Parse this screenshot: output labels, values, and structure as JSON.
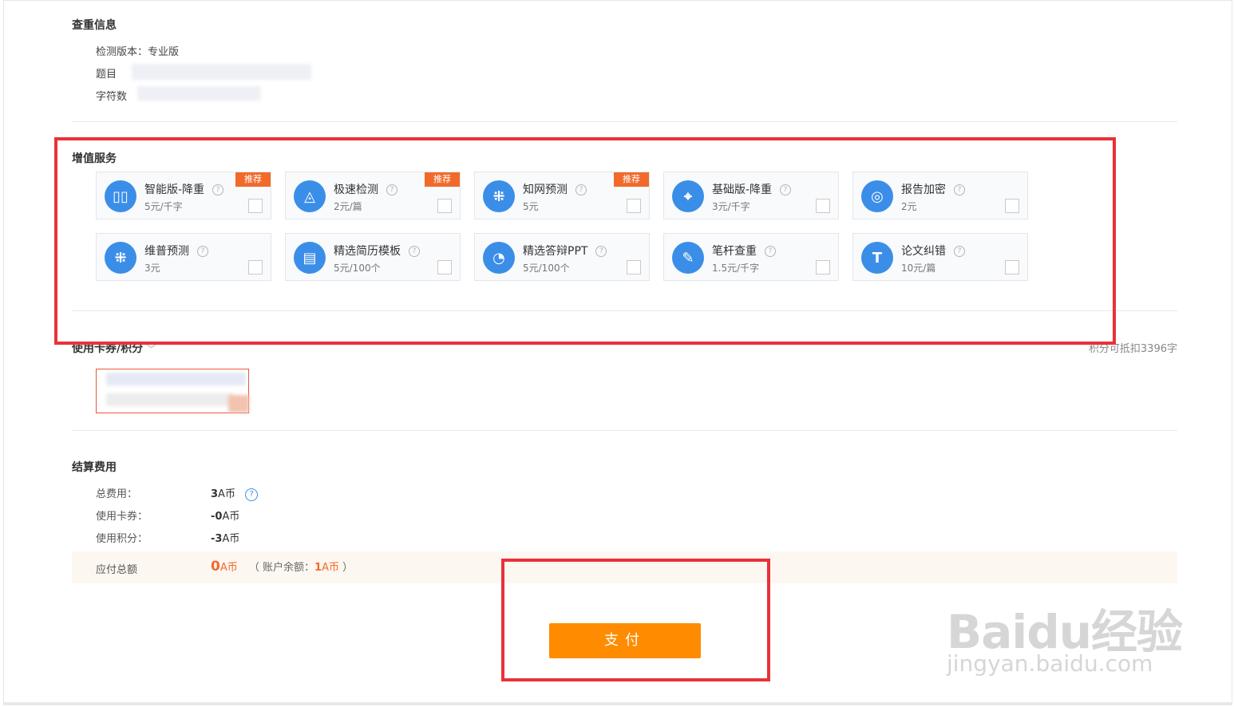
{
  "check_info": {
    "title": "查重信息",
    "version_label": "检测版本：专业版",
    "topic_label": "题目",
    "chars_label": "字符数"
  },
  "services": {
    "title": "增值服务",
    "items": [
      {
        "name": "智能版-降重",
        "price": "5元/千字",
        "badge": "推荐",
        "icon": "bar-chart-icon",
        "glyph": "▯▯"
      },
      {
        "name": "极速检测",
        "price": "2元/篇",
        "badge": "推荐",
        "icon": "pyramid-icon",
        "glyph": "◬"
      },
      {
        "name": "知网预测",
        "price": "5元",
        "badge": "推荐",
        "icon": "grid-icon",
        "glyph": "⁜"
      },
      {
        "name": "基础版-降重",
        "price": "3元/千字",
        "badge": "",
        "icon": "crosshair-icon",
        "glyph": "⌖"
      },
      {
        "name": "报告加密",
        "price": "2元",
        "badge": "",
        "icon": "shield-icon",
        "glyph": "◎"
      },
      {
        "name": "维普预测",
        "price": "3元",
        "badge": "",
        "icon": "grid-icon",
        "glyph": "⁜"
      },
      {
        "name": "精选简历模板",
        "price": "5元/100个",
        "badge": "",
        "icon": "document-icon",
        "glyph": "▤"
      },
      {
        "name": "精选答辩PPT",
        "price": "5元/100个",
        "badge": "",
        "icon": "pie-chart-icon",
        "glyph": "◔"
      },
      {
        "name": "笔杆查重",
        "price": "1.5元/千字",
        "badge": "",
        "icon": "pen-icon",
        "glyph": "✎"
      },
      {
        "name": "论文纠错",
        "price": "10元/篇",
        "badge": "",
        "icon": "text-icon",
        "glyph": "T"
      }
    ],
    "help_glyph": "?"
  },
  "coupon": {
    "title": "使用卡券/积分",
    "chevron": "﹀",
    "points_note": "积分可抵扣3396字"
  },
  "settlement": {
    "title": "结算费用",
    "total_label": "总费用：",
    "total_value": "3",
    "coupon_label": "使用卡券：",
    "coupon_value": "-0",
    "points_label": "使用积分：",
    "points_value": "-3",
    "currency": "A币",
    "payable_label": "应付总额",
    "payable_value": "0",
    "balance_prefix": "（ 账户余额：",
    "balance_value": "1",
    "balance_suffix": " ）"
  },
  "pay_button_label": "支付",
  "watermark": {
    "logo": "Baidu经验",
    "url": "jingyan.baidu.com"
  },
  "colors": {
    "accent_blue": "#3b8ee8",
    "badge_orange": "#f26a2b",
    "pay_orange": "#ff8c00",
    "highlight_red": "#e8323a"
  }
}
